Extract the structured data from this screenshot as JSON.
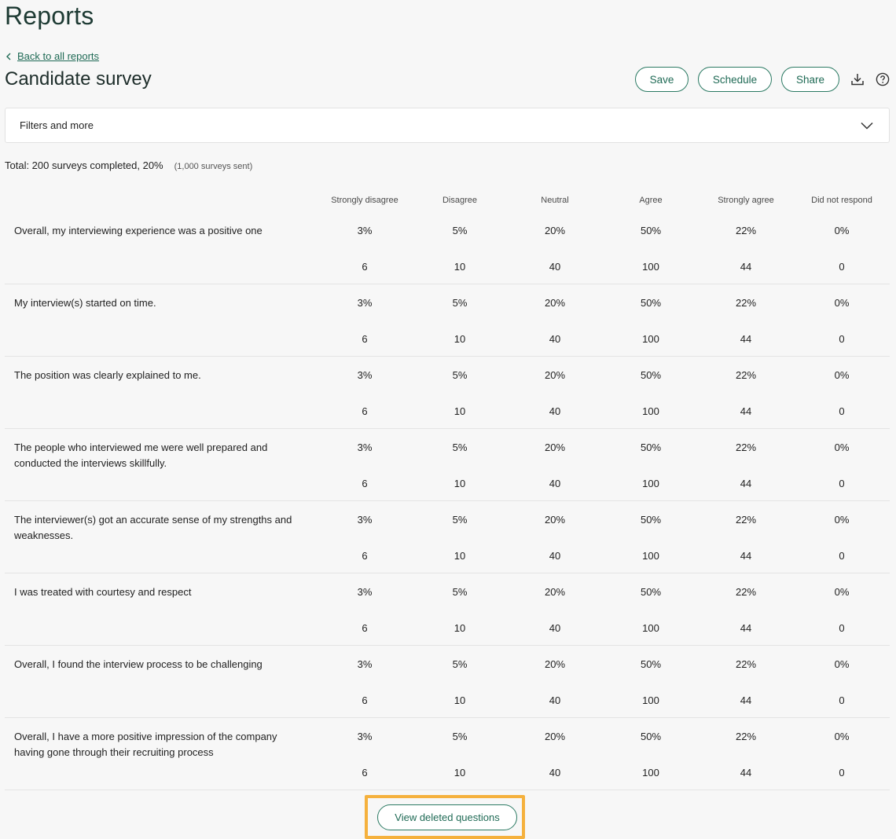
{
  "page": {
    "title": "Reports"
  },
  "nav": {
    "back_label": "Back to all reports"
  },
  "report": {
    "title": "Candidate survey"
  },
  "toolbar": {
    "save_label": "Save",
    "schedule_label": "Schedule",
    "share_label": "Share",
    "download_icon": "download-icon",
    "help_icon": "help-icon"
  },
  "filters": {
    "label": "Filters and more",
    "icon": "chevron-down-icon"
  },
  "summary": {
    "total_text": "Total: 200 surveys completed, 20%",
    "sent_text": "(1,000 surveys sent)"
  },
  "table": {
    "columns": [
      "Strongly disagree",
      "Disagree",
      "Neutral",
      "Agree",
      "Strongly agree",
      "Did not respond"
    ],
    "rows": [
      {
        "question": "Overall, my interviewing experience was a positive one",
        "percentages": [
          "3%",
          "5%",
          "20%",
          "50%",
          "22%",
          "0%"
        ],
        "counts": [
          "6",
          "10",
          "40",
          "100",
          "44",
          "0"
        ]
      },
      {
        "question": "My interview(s) started on time.",
        "percentages": [
          "3%",
          "5%",
          "20%",
          "50%",
          "22%",
          "0%"
        ],
        "counts": [
          "6",
          "10",
          "40",
          "100",
          "44",
          "0"
        ]
      },
      {
        "question": "The position was clearly explained to me.",
        "percentages": [
          "3%",
          "5%",
          "20%",
          "50%",
          "22%",
          "0%"
        ],
        "counts": [
          "6",
          "10",
          "40",
          "100",
          "44",
          "0"
        ]
      },
      {
        "question": "The people who interviewed me were well prepared and conducted the interviews skillfully.",
        "percentages": [
          "3%",
          "5%",
          "20%",
          "50%",
          "22%",
          "0%"
        ],
        "counts": [
          "6",
          "10",
          "40",
          "100",
          "44",
          "0"
        ]
      },
      {
        "question": "The interviewer(s) got an accurate sense of my strengths and weaknesses.",
        "percentages": [
          "3%",
          "5%",
          "20%",
          "50%",
          "22%",
          "0%"
        ],
        "counts": [
          "6",
          "10",
          "40",
          "100",
          "44",
          "0"
        ]
      },
      {
        "question": "I was treated with courtesy and respect",
        "percentages": [
          "3%",
          "5%",
          "20%",
          "50%",
          "22%",
          "0%"
        ],
        "counts": [
          "6",
          "10",
          "40",
          "100",
          "44",
          "0"
        ]
      },
      {
        "question": "Overall, I found the interview process to be challenging",
        "percentages": [
          "3%",
          "5%",
          "20%",
          "50%",
          "22%",
          "0%"
        ],
        "counts": [
          "6",
          "10",
          "40",
          "100",
          "44",
          "0"
        ]
      },
      {
        "question": "Overall, I have a more positive impression of the company having gone through their recruiting process",
        "percentages": [
          "3%",
          "5%",
          "20%",
          "50%",
          "22%",
          "0%"
        ],
        "counts": [
          "6",
          "10",
          "40",
          "100",
          "44",
          "0"
        ]
      }
    ]
  },
  "footer": {
    "view_deleted_label": "View deleted questions"
  },
  "colors": {
    "accent": "#1f6a55",
    "highlight": "#f5b13d",
    "background": "#f7f7f7"
  }
}
